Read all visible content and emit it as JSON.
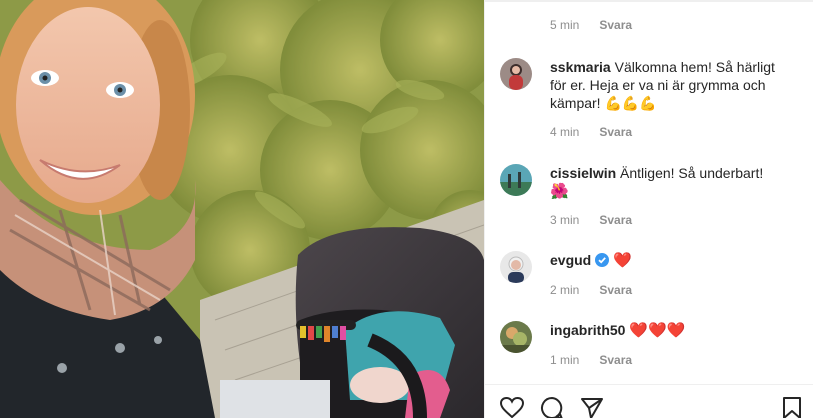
{
  "icons": {
    "like": "heart-outline-icon",
    "comment": "comment-bubble-icon",
    "share": "paper-plane-icon",
    "save": "bookmark-icon",
    "verified": "verified-badge-icon"
  },
  "colors": {
    "username": "#262626",
    "muted": "#8e8e8e",
    "verified": "#3897f0",
    "heart": "#e0245e"
  },
  "top_meta": {
    "time": "5 min",
    "reply": "Svara"
  },
  "comments": [
    {
      "username": "sskmaria",
      "text": "Välkomna hem! Så härligt för er. Heja er va ni är grymma och kämpar!",
      "emoji": "💪💪💪",
      "time": "4 min",
      "reply": "Svara"
    },
    {
      "username": "cissielwin",
      "text": "Äntligen! Så underbart!",
      "emoji": "🌺",
      "time": "3 min",
      "reply": "Svara"
    },
    {
      "username": "evgud",
      "verified": true,
      "text": "",
      "emoji": "❤️",
      "time": "2 min",
      "reply": "Svara"
    },
    {
      "username": "ingabrith50",
      "text": "",
      "emoji": "❤️❤️❤️",
      "time": "1 min",
      "reply": "Svara"
    }
  ]
}
